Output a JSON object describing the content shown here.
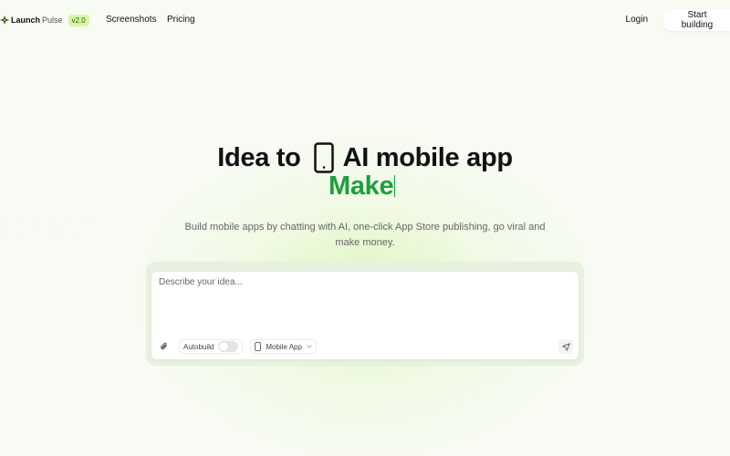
{
  "header": {
    "brand_primary": "Launch",
    "brand_secondary": "Pulse",
    "version_badge": "v2.0",
    "nav": [
      {
        "label": "Screenshots"
      },
      {
        "label": "Pricing"
      }
    ],
    "login_label": "Login",
    "cta_label": "Start building"
  },
  "hero": {
    "title_before": "Idea to",
    "title_after": "AI mobile app",
    "typed_word": "Make",
    "subtitle": "Build mobile apps by chatting with AI, one-click App Store publishing, go viral and make money."
  },
  "prompt": {
    "placeholder": "Describe your idea...",
    "value": "",
    "autobuild_label": "Autobuild",
    "autobuild_on": false,
    "platform_label": "Mobile App"
  },
  "colors": {
    "accent": "#1e9e3e",
    "badge_bg": "#d8f5a6",
    "page_bg": "#f7fbf3"
  },
  "icons": {
    "logo": "sparkle-icon",
    "phone": "phone-icon",
    "attach": "paperclip-icon",
    "platform": "phone-icon",
    "dropdown": "chevron-down-icon",
    "send": "send-icon"
  }
}
